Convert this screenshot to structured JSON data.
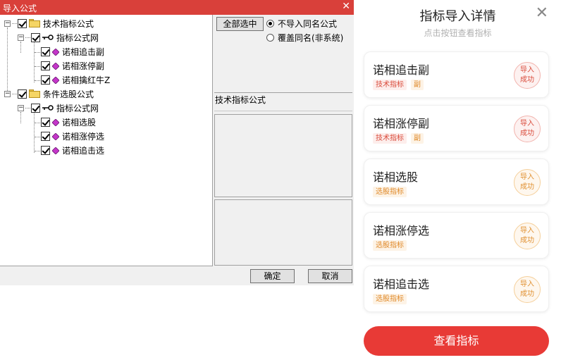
{
  "dialog": {
    "title": "导入公式",
    "close_glyph": "✕",
    "tree": [
      {
        "label": "技术指标公式",
        "level": 0,
        "icon": "folder-icon"
      },
      {
        "label": "指标公式网",
        "level": 1,
        "icon": "key-icon"
      },
      {
        "label": "诺相追击副",
        "level": 2,
        "icon": "gem-icon"
      },
      {
        "label": "诺相涨停副",
        "level": 2,
        "icon": "gem-icon"
      },
      {
        "label": "诺相擒红牛Z",
        "level": 2,
        "icon": "gem-icon"
      },
      {
        "label": "条件选股公式",
        "level": 0,
        "icon": "folder-icon"
      },
      {
        "label": "指标公式网",
        "level": 1,
        "icon": "key-icon"
      },
      {
        "label": "诺相选股",
        "level": 2,
        "icon": "gem-icon"
      },
      {
        "label": "诺相涨停选",
        "level": 2,
        "icon": "gem-icon"
      },
      {
        "label": "诺相追击选",
        "level": 2,
        "icon": "gem-icon"
      }
    ],
    "select_all_label": "全部选中",
    "radio_options": [
      {
        "label": "不导入同名公式",
        "selected": true
      },
      {
        "label": "覆盖同名(非系统)",
        "selected": false
      }
    ],
    "info_label": "技术指标公式",
    "ok_label": "确定",
    "cancel_label": "取消",
    "accent_color": "#d9403a"
  },
  "panel": {
    "title": "指标导入详情",
    "subtitle": "点击按钮查看指标",
    "close_glyph": "✕",
    "items": [
      {
        "name": "诺相追击副",
        "tags": [
          "技术指标",
          "副"
        ],
        "status_line1": "导入",
        "status_line2": "成功",
        "tone": "red"
      },
      {
        "name": "诺相涨停副",
        "tags": [
          "技术指标",
          "副"
        ],
        "status_line1": "导入",
        "status_line2": "成功",
        "tone": "red"
      },
      {
        "name": "诺相选股",
        "tags": [
          "选股指标"
        ],
        "status_line1": "导入",
        "status_line2": "成功",
        "tone": "orange"
      },
      {
        "name": "诺相涨停选",
        "tags": [
          "选股指标"
        ],
        "status_line1": "导入",
        "status_line2": "成功",
        "tone": "orange"
      },
      {
        "name": "诺相追击选",
        "tags": [
          "选股指标"
        ],
        "status_line1": "导入",
        "status_line2": "成功",
        "tone": "orange"
      }
    ],
    "view_button_label": "查看指标",
    "button_color": "#e83a36"
  }
}
